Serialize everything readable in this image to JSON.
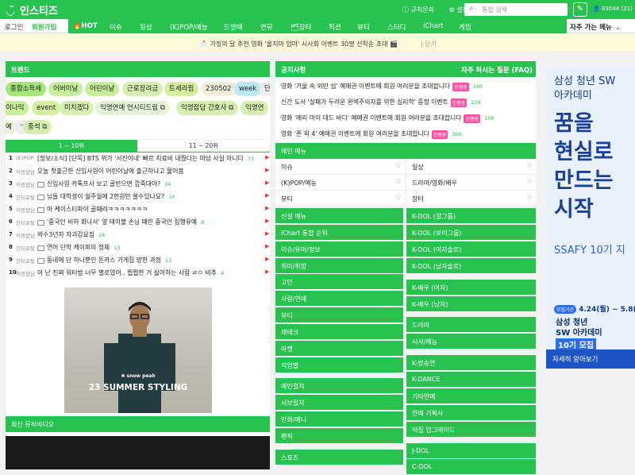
{
  "header": {
    "logo": "인스티즈",
    "links": [
      "규칙문의",
      "설정"
    ],
    "search_placeholder": "통합 검색",
    "user": "83044 (21)"
  },
  "nav": {
    "login": "로그인",
    "join": "회원가입",
    "items": [
      "HOT",
      "이슈",
      "일상",
      "(K)POP/예능",
      "드영배",
      "연뮤",
      "장터",
      "픽션",
      "뷰티",
      "스터디",
      "iChart",
      "게임"
    ],
    "favorites": "자주 가는 메뉴"
  },
  "notice_bar": {
    "text": "가정의 달 추천 영화 '올지마 엄마' 시사회 이벤트 30명 선착순 초대",
    "close": "닫기"
  },
  "trend": {
    "title": "트렌드",
    "chips": [
      "종합소득세",
      "어버이날",
      "어린이날",
      "근로장려금",
      "트세라핌",
      "230502",
      "week",
      "단",
      "이나믹",
      "event",
      "미치겠다",
      "익명연예 언시티드림",
      "익명잡담 간호사",
      "익명연",
      "예",
      "ㄱ",
      "중석"
    ],
    "tab_active": "1 ~ 10위",
    "tab_inactive": "11 ~ 20위",
    "hot": [
      {
        "rank": "1",
        "cat": "(K)POP",
        "title": "[정보/소식] [단독] BTS 뷔가 '서진이네' 빠르 치료비 내줬다는 미담 사실 아니다",
        "count": "73"
      },
      {
        "rank": "2",
        "cat": "익명잡담",
        "title": "오늘 첫출근한 신입사원이 어린이날에 출근하냐고 물어봄",
        "count": ""
      },
      {
        "rank": "3",
        "cat": "익명잡담",
        "title": "신입사원 카톡프사 보고 골반으면 깝죽대야?",
        "count": "34"
      },
      {
        "rank": "4",
        "cat": "인티포털",
        "title": "님들 대학생이 월주월에 2만원만 쓸수있나요?",
        "count": "10"
      },
      {
        "rank": "5",
        "cat": "익명잡담",
        "title": "아 케이스티파이 골때려ㅋㅋㅋㅋㅋㅋㅋ",
        "count": ""
      },
      {
        "rank": "6",
        "cat": "인티포털",
        "title": "'중국인 비하 화나서' 옆 테이블 손님 때린 중국인 집행유예",
        "count": "8"
      },
      {
        "rank": "7",
        "cat": "익명잡담",
        "title": "박수3년차 자괴감요짐",
        "count": "28"
      },
      {
        "rank": "8",
        "cat": "인티포털",
        "title": "연어 단학 케이퍼의 정체",
        "count": "13"
      },
      {
        "rank": "9",
        "cat": "인티포털",
        "title": "동네에 단 하나뿐인 돈까스 가게집 망한 과정",
        "count": "13"
      },
      {
        "rank": "10",
        "cat": "익명잡담",
        "title": "아 난 진짜 워터밤 너무 별로였어.. 찝찝한 거 싫어하는 사람 ㄹㅇ 비추",
        "count": "4"
      }
    ],
    "ad_brand": "✱ snow peak",
    "ad_text": "23 SUMMER STYLING",
    "music_video_title": "최신 뮤직비디오"
  },
  "notices": {
    "title": "공지사항",
    "faq": "자주 하시는 질문 (FAQ)",
    "rows": [
      {
        "text": "영화 '거울 속 외딴 섬' 예매권 이벤트에 회원 여러분을 초대합니다",
        "badge": "진행중",
        "count": "190"
      },
      {
        "text": "신간 도서 '실패가 두려운 완벽주의자를 위한 심리학' 증정 이벤트",
        "badge": "진행중",
        "count": "229"
      },
      {
        "text": "영화 '메리 마이 데드 바디' 예매권 이벤트에 회원 여러분을 초대합니다",
        "badge": "진행중",
        "count": "158"
      },
      {
        "text": "영화 '존 윅 4' 예매권 이벤트에 회원 여러분을 초대합니다",
        "badge": "진행중",
        "count": "306"
      }
    ]
  },
  "menu": {
    "main_title": "메인 메뉴",
    "main_left": [
      "이슈",
      "(K)POP/예능",
      "뷰티"
    ],
    "main_right": [
      "일상",
      "드라마/영화/배우",
      "장터"
    ],
    "left_sections": [
      [
        "신설 메뉴",
        "iChart 통합 순위",
        "이슈/유머/정보",
        "취미/취향"
      ],
      [
        "고민",
        "사랑/연애",
        "뷰티",
        "재테크",
        "마켓",
        "직업별"
      ],
      [
        "예인컬쳐",
        "서브컬쳐",
        "만화/애니",
        "팬픽"
      ],
      [
        "스포츠"
      ]
    ],
    "right_sections": [
      [
        "K-DOL (걸그룹)",
        "K-DOL (보이그룹)",
        "K-DOL (여자솔로)",
        "K-DOL (남자솔로)"
      ],
      [
        "K-배우 (여자)",
        "K-배우 (남자)"
      ],
      [
        "드라마",
        "시사/예능"
      ],
      [
        "K-방송연",
        "K-DANCE",
        "기타연예",
        "연예 기획사",
        "덕질 업그레이드"
      ],
      [
        "J-DOL",
        "C-DOL"
      ]
    ]
  },
  "side_ad": {
    "line1": "삼성 청년 SW",
    "line2": "아카데미",
    "big": [
      "꿈을",
      "현실로",
      "만드는",
      "시작"
    ],
    "ssafy": "SSAFY 10기 지",
    "apply": "모집기간",
    "date": "4.24(월) ~ 5.8(월)",
    "logo_line1": "삼성 청년",
    "logo_line2": "SW 아카데미",
    "recruit": "10기 모집",
    "more": "자세히 알아보기"
  },
  "colors": {
    "brand": "#28c250",
    "badge": "#ff4fa0",
    "ad_blue": "#1d55c4"
  }
}
